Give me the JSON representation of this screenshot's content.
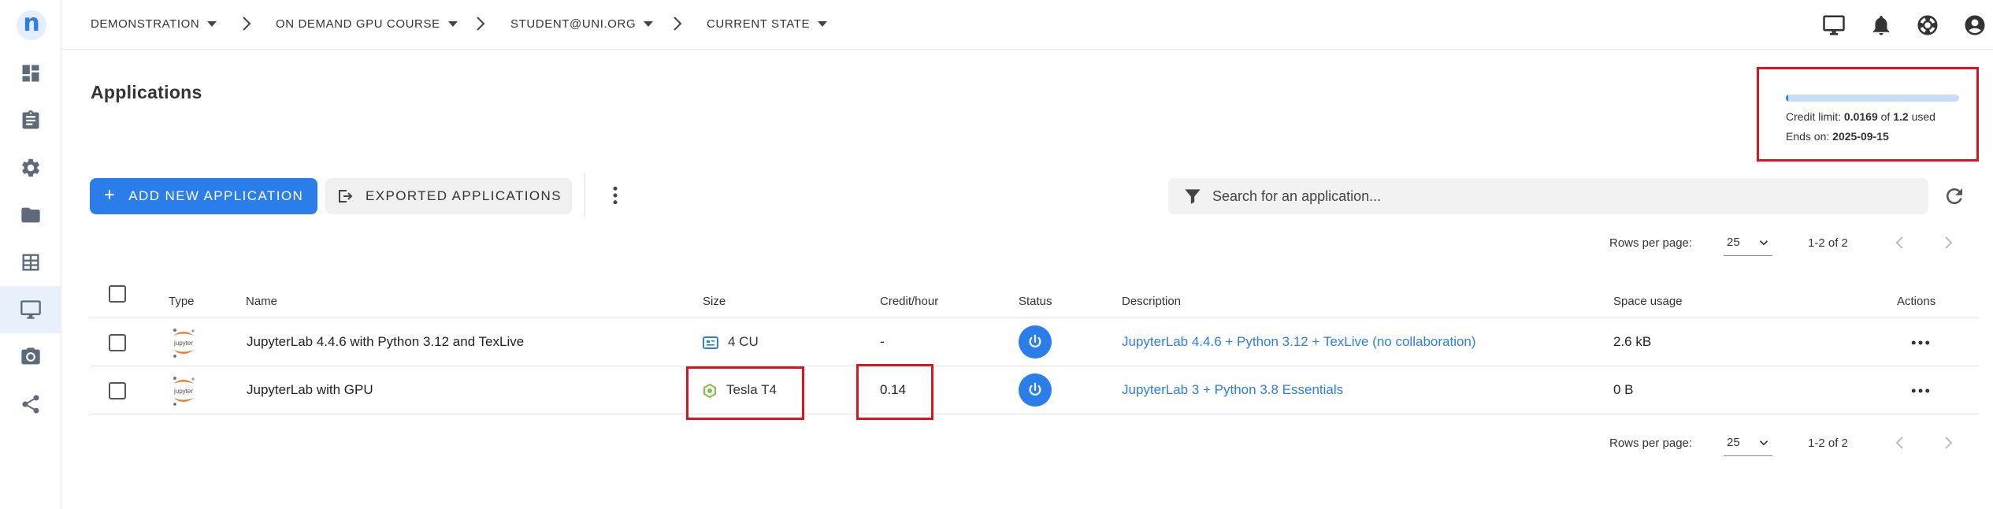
{
  "breadcrumbs": [
    {
      "label": "DEMONSTRATION"
    },
    {
      "label": "ON DEMAND GPU COURSE"
    },
    {
      "label": "STUDENT@UNI.ORG"
    },
    {
      "label": "CURRENT STATE"
    }
  ],
  "logo_letter": "n",
  "sidebar": {
    "items": [
      {
        "icon": "dashboard-icon"
      },
      {
        "icon": "clipboard-icon"
      },
      {
        "icon": "gear-icon"
      },
      {
        "icon": "folder-icon"
      },
      {
        "icon": "table-icon"
      },
      {
        "icon": "monitor-icon",
        "active": true
      },
      {
        "icon": "camera-icon"
      },
      {
        "icon": "share-icon"
      }
    ]
  },
  "page": {
    "title": "Applications"
  },
  "credit": {
    "limit_label": "Credit limit:",
    "used_value": "0.0169",
    "of_label": "of",
    "limit_value": "1.2",
    "used_label": "used",
    "ends_label": "Ends on:",
    "ends_value": "2025-09-15",
    "used_fraction": 0.0141,
    "highlight_color": "#d9151f"
  },
  "toolbar": {
    "add_label": "ADD NEW APPLICATION",
    "exported_label": "EXPORTED APPLICATIONS",
    "search_placeholder": "Search for an application..."
  },
  "pagination": {
    "rows_per_page_label": "Rows per page:",
    "rows_per_page_value": "25",
    "range": "1-2 of 2"
  },
  "table": {
    "headers": {
      "type": "Type",
      "name": "Name",
      "size": "Size",
      "credit": "Credit/hour",
      "status": "Status",
      "description": "Description",
      "space": "Space usage",
      "actions": "Actions"
    },
    "rows": [
      {
        "type_logo_text": "jupyter",
        "name": "JupyterLab 4.4.6 with Python 3.12 and TexLive",
        "size": "4 CU",
        "size_icon": "cpu-card-icon",
        "credit": "-",
        "description": "JupyterLab 4.4.6 + Python 3.12 + TexLive (no collaboration)",
        "space": "2.6 kB"
      },
      {
        "type_logo_text": "jupyter",
        "name": "JupyterLab with GPU",
        "size": "Tesla T4",
        "size_icon": "gpu-chip-icon",
        "credit": "0.14",
        "description": "JupyterLab 3 + Python 3.8 Essentials",
        "space": "0 B"
      }
    ]
  },
  "colors": {
    "accent": "#2b7de9",
    "highlight": "#d9151f",
    "gpu_icon": "#7cc242"
  }
}
